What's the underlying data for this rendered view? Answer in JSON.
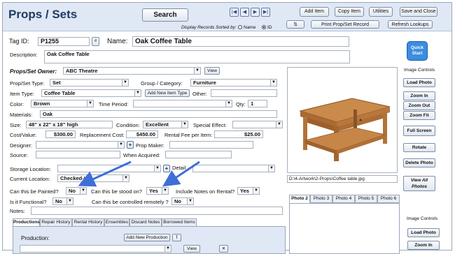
{
  "header": {
    "title": "Props / Sets",
    "search_label": "Search",
    "nav": [
      "|◀",
      "◀",
      "▶",
      "▶|"
    ],
    "sorted_by_label": "Display Records Sorted by:",
    "sort_name_label": "Name",
    "sort_id_label": "ID",
    "buttons": {
      "add_item": "Add Item",
      "copy_item": "Copy Item",
      "utilities": "Utilities",
      "save_close": "Save and Close",
      "print": "Print Prop/Set Record",
      "refresh": "Refresh Lookups"
    }
  },
  "record": {
    "tag_id_label": "Tag ID:",
    "tag_id": "P1255",
    "hash": "#",
    "name_label": "Name:",
    "name": "Oak Coffee Table",
    "description_label": "Description:",
    "description": "Oak Coffee Table",
    "owner_label": "Props/Set Owner:",
    "owner": "ABC Theatre",
    "view_label": "View",
    "type_label": "Prop/Set Type:",
    "type": "Set",
    "group_label": "Group / Category:",
    "group": "Furniture",
    "item_type_label": "Item Type:",
    "item_type": "Coffee Table",
    "add_item_type": "Add New Item Type",
    "other_label": "Other:",
    "color_label": "Color:",
    "color": "Brown",
    "time_period_label": "Time Period:",
    "qty_label": "Qty:",
    "qty": "1",
    "materials_label": "Materials:",
    "materials": "Oak",
    "size_label": "Size:",
    "size": "48\" x 22\" x 18\" high",
    "condition_label": "Condition:",
    "condition": "Excellent",
    "special_effect_label": "Special Effect:",
    "cost_label": "Cost/Value:",
    "cost": "$300.00",
    "replacement_label": "Replacement Cost:",
    "replacement": "$450.00",
    "rental_fee_label": "Rental Fee per Item:",
    "rental_fee": "$25.00",
    "designer_label": "Designer:",
    "prop_maker_label": "Prop Maker:",
    "source_label": "Source:",
    "when_acquired_label": "When Acquired:",
    "storage_label": "Storage Location:",
    "detail_label": "Detail",
    "current_location_label": "Current Location:",
    "current_location": "Checked-In",
    "painted_label": "Can this be Painted?",
    "painted": "No",
    "stood_label": "Can this be stood on?",
    "stood": "Yes",
    "notes_rental_label": "Include Notes on Rental?",
    "notes_rental": "Yes",
    "functional_label": "Is it Functional?",
    "functional": "No",
    "remote_label": "Can this be controlled remotely ?",
    "remote": "No",
    "notes_label": "Notes:"
  },
  "photo": {
    "path": "D:\\4-Artwork\\2-Props\\Coffee table.jpg",
    "image_controls": "Image Controls",
    "quick_start": "Quick Start",
    "buttons": [
      "Load Photo",
      "Zoom In",
      "Zoom Out",
      "Zoom Fit",
      "Full Screen",
      "Rotate",
      "Delete Photo",
      "View All Photos"
    ],
    "tabs": [
      "Photo 2",
      "Photo 3",
      "Photo 4",
      "Photo 5",
      "Photo 6"
    ],
    "lower_controls": "Image Controls",
    "lower_buttons": [
      "Load Photo",
      "Zoom In"
    ]
  },
  "bottom": {
    "tabs": [
      "Productions",
      "Repair History",
      "Rental History",
      "Ensembles",
      "Discard Notes",
      "Borrowed Items"
    ],
    "production_label": "Production:",
    "add_production": "Add New Production",
    "t_label": "T",
    "view_label": "View"
  },
  "colors": {
    "header_bg": "#dfe8f4",
    "title": "#1f3b63",
    "annotation_arrow": "#3f6fd6"
  }
}
